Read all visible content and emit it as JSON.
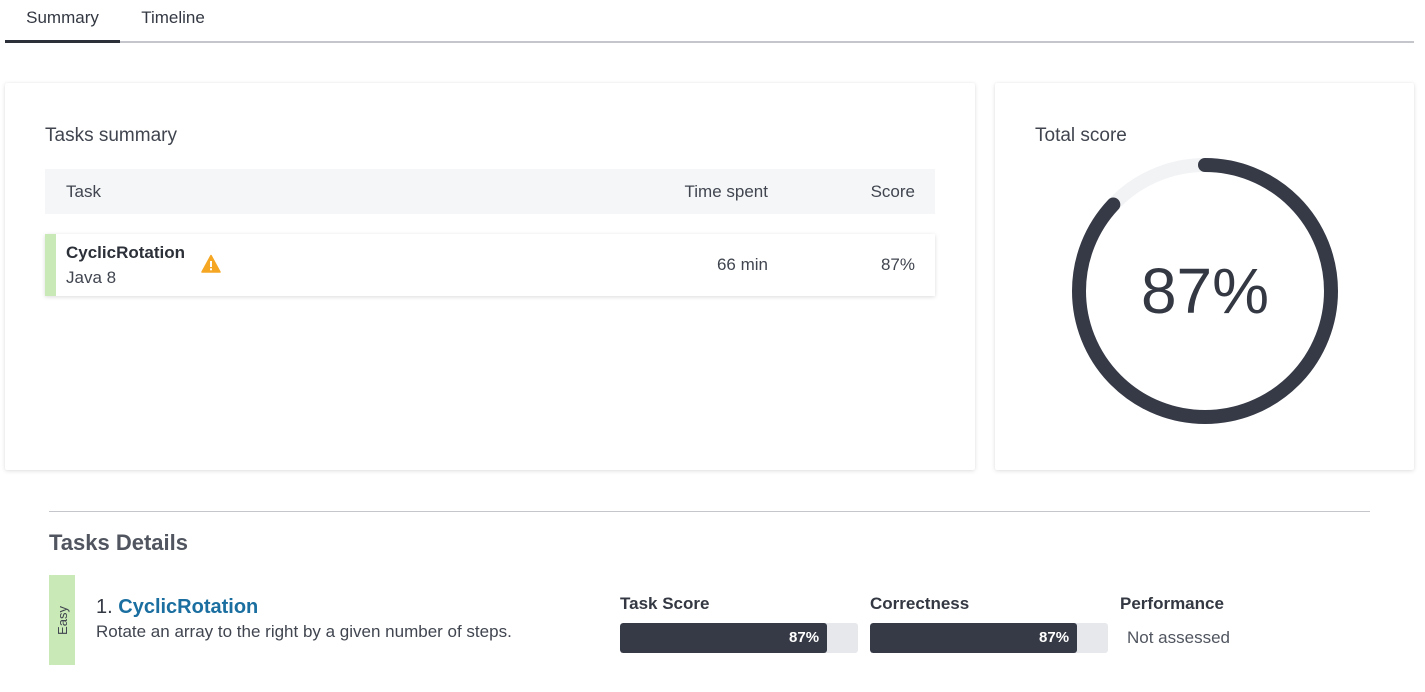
{
  "tabs": [
    {
      "label": "Summary",
      "active": true
    },
    {
      "label": "Timeline",
      "active": false
    }
  ],
  "tasks_summary": {
    "title": "Tasks summary",
    "columns": {
      "task": "Task",
      "time": "Time spent",
      "score": "Score"
    },
    "rows": [
      {
        "name": "CyclicRotation",
        "language": "Java 8",
        "icon": "warning-icon",
        "time": "66 min",
        "score": "87%"
      }
    ]
  },
  "total_score": {
    "title": "Total score",
    "value_label": "87%",
    "fraction": 0.87
  },
  "details": {
    "title": "Tasks Details",
    "tasks": [
      {
        "difficulty": "Easy",
        "number": "1.",
        "name": "CyclicRotation",
        "description": "Rotate an array to the right by a given number of steps.",
        "metrics": {
          "task_score": {
            "label": "Task Score",
            "value": "87%",
            "fraction": 0.87
          },
          "correctness": {
            "label": "Correctness",
            "value": "87%",
            "fraction": 0.87
          },
          "performance": {
            "label": "Performance",
            "value": "Not assessed"
          }
        }
      }
    ]
  },
  "colors": {
    "accent_dark": "#363a46",
    "easy_green": "#c9e9b6",
    "link_blue": "#1a6fa0",
    "warning": "#f5a623"
  }
}
